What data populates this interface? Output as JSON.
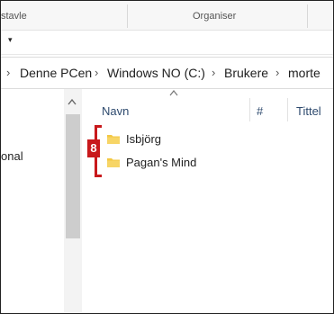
{
  "ribbon": {
    "group_left": "stavle",
    "group_mid": "Organiser"
  },
  "quick_access": {
    "dropdown_glyph": "▾"
  },
  "breadcrumb": {
    "items": [
      "Denne PCen",
      "Windows NO (C:)",
      "Brukere",
      "morte"
    ],
    "separator": "›"
  },
  "nav_pane": {
    "partial_item": "onal"
  },
  "columns": {
    "name": "Navn",
    "number": "#",
    "title": "Tittel",
    "sort_indicator": "^"
  },
  "files": [
    {
      "name": "Isbjörg",
      "icon": "folder-icon"
    },
    {
      "name": "Pagan's Mind",
      "icon": "folder-icon"
    }
  ],
  "callout": {
    "number": "8",
    "color": "#c8191c"
  },
  "colors": {
    "folder": "#f3c843",
    "header_text": "#2e4a6e"
  }
}
